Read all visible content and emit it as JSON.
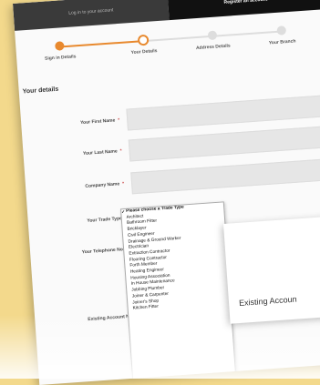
{
  "tabs": {
    "login": "Log in to your account",
    "register": "Register an account"
  },
  "steps": [
    {
      "label": "Sign in Details",
      "state": "done"
    },
    {
      "label": "Your Details",
      "state": "current"
    },
    {
      "label": "Address Details",
      "state": "todo"
    },
    {
      "label": "Your Branch",
      "state": "todo"
    }
  ],
  "section_title": "Your details",
  "fields": {
    "first_name": "Your First Name",
    "last_name": "Your Last Name",
    "company_name": "Company Name",
    "trade_type": "Your Trade Type",
    "telephone": "Your Telephone No.",
    "existing_account": "Existing Account No."
  },
  "required_mark": "*",
  "trade_options": [
    "Please choose a Trade Type",
    "Architect",
    "Bathroom Fitter",
    "Bricklayer",
    "Civil Engineer",
    "Drainage & Ground Worker",
    "Electrician",
    "Extraction Contractor",
    "Flooring Contractor",
    "Forth Member",
    "Heating Engineer",
    "Housing Association",
    "In House Maintenance",
    "Jobbing Plumber",
    "Joiner & Carpenter",
    "Joiner's Shop",
    "Kitchen Fitter"
  ],
  "overlay_label": "Existing Accoun",
  "colors": {
    "accent": "#e8892e",
    "background": "#f3d98c"
  }
}
